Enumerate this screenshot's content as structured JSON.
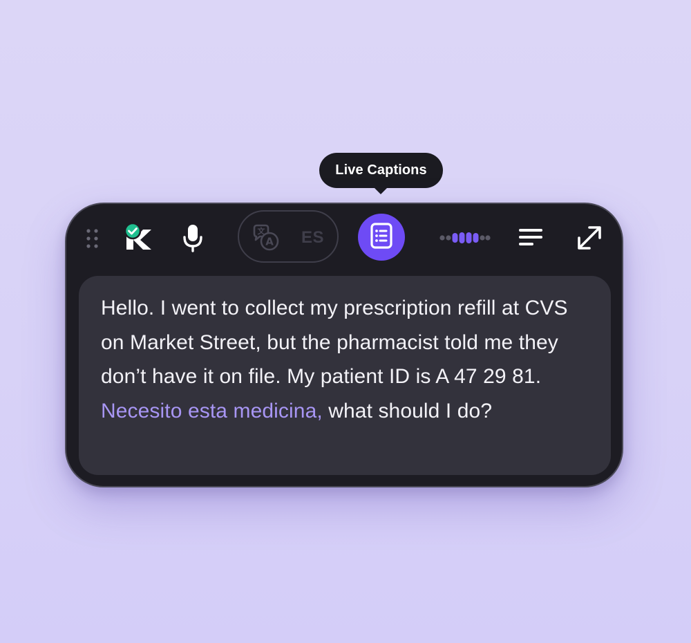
{
  "tooltip": {
    "label": "Live Captions"
  },
  "toolbar": {
    "drag_handle_icon": "drag-dots-icon",
    "logo_icon": "k-logo-verified-icon",
    "mic_icon": "microphone-icon",
    "translate": {
      "icon": "translate-icon",
      "language": "ES"
    },
    "captions_icon": "document-lines-icon",
    "audio_level_icon": "audio-level-dots-icon",
    "menu_icon": "text-lines-icon",
    "expand_icon": "expand-arrows-icon"
  },
  "caption": {
    "text_english": "Hello. I went to collect my prescription refill at CVS on Market Street, but the pharmacist told me they don’t have it on file. My patient ID is A 47 29 81.",
    "text_foreign": "Necesito esta medicina,",
    "text_after": "what should I do?"
  },
  "colors": {
    "accent": "#6e4bf5",
    "foreign_text": "#a896f4",
    "verified_badge": "#1fbf8f",
    "widget_bg": "#1d1c23",
    "panel_bg": "#33323c",
    "page_bg": "#dcd6f7"
  }
}
